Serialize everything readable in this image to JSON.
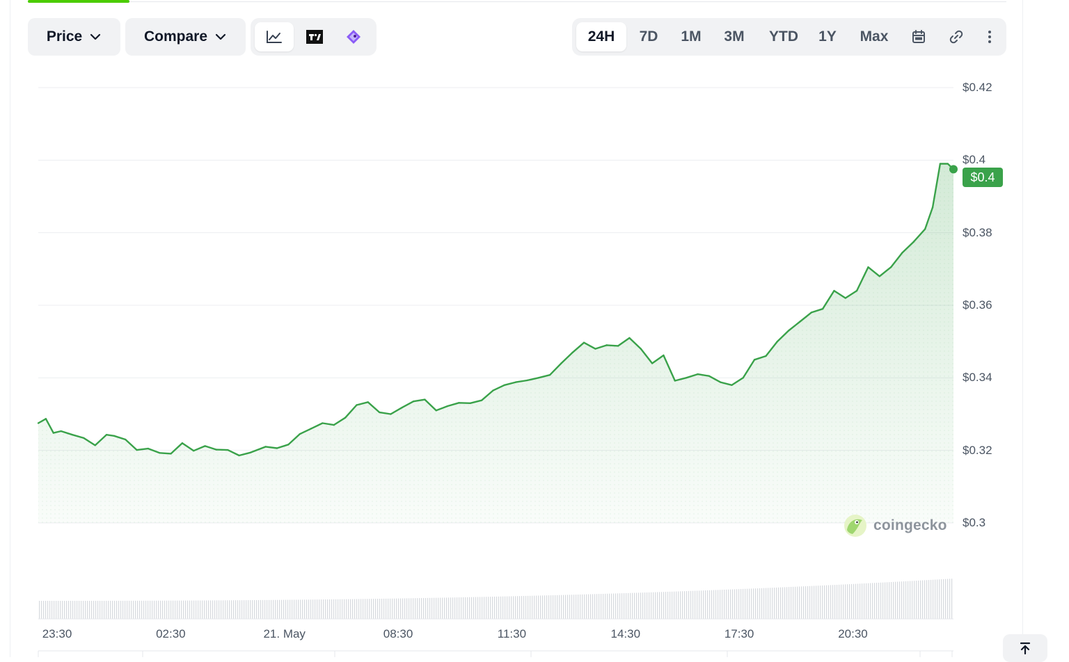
{
  "toolbar": {
    "price_label": "Price",
    "compare_label": "Compare",
    "chart_modes": [
      {
        "icon": "line-chart-icon",
        "active": true
      },
      {
        "icon": "tradingview-icon",
        "active": false
      },
      {
        "icon": "gecko-terminal-icon",
        "active": false
      }
    ],
    "ranges": [
      "24H",
      "7D",
      "1M",
      "3M",
      "YTD",
      "1Y",
      "Max"
    ],
    "active_range": "24H",
    "extra_icons": [
      "calendar-icon",
      "link-icon",
      "more-vertical-icon"
    ]
  },
  "current_price_label": "$0.4",
  "watermark": "coingecko",
  "colors": {
    "line": "#3aa24a",
    "badge": "#3aa24a",
    "tab_accent": "#4BCC00",
    "grid": "#eceef1",
    "axis_text": "#4b5563"
  },
  "chart_data": {
    "type": "area",
    "title": "",
    "xlabel": "",
    "ylabel": "",
    "ylim": [
      0.3,
      0.42
    ],
    "y_ticks": [
      "$0.42",
      "$0.4",
      "$0.38",
      "$0.36",
      "$0.34",
      "$0.32",
      "$0.3"
    ],
    "y_tick_values": [
      0.42,
      0.4,
      0.38,
      0.36,
      0.34,
      0.32,
      0.3
    ],
    "x_ticks": [
      "23:30",
      "02:30",
      "21. May",
      "08:30",
      "11:30",
      "14:30",
      "17:30",
      "20:30"
    ],
    "x_tick_hours": [
      0,
      3,
      6,
      9,
      12,
      15,
      18,
      21
    ],
    "xlim_hours": [
      0,
      24.15
    ],
    "grid": true,
    "series": [
      {
        "x_hours": [
          0,
          0.2,
          0.4,
          0.6,
          0.9,
          1.2,
          1.5,
          1.8,
          2.0,
          2.3,
          2.6,
          2.9,
          3.2,
          3.5,
          3.8,
          4.1,
          4.4,
          4.7,
          5.0,
          5.3,
          5.6,
          6.0,
          6.3,
          6.6,
          6.9,
          7.2,
          7.5,
          7.8,
          8.1,
          8.4,
          8.7,
          9.0,
          9.3,
          9.6,
          9.9,
          10.2,
          10.5,
          10.8,
          11.1,
          11.4,
          11.7,
          12.0,
          12.3,
          12.6,
          12.9,
          13.2,
          13.5,
          13.8,
          14.1,
          14.4,
          14.7,
          15.0,
          15.3,
          15.6,
          15.9,
          16.2,
          16.5,
          16.8,
          17.1,
          17.4,
          17.7,
          18.0,
          18.3,
          18.6,
          18.9,
          19.2,
          19.5,
          19.8,
          20.1,
          20.4,
          20.7,
          21.0,
          21.3,
          21.6,
          21.9,
          22.2,
          22.5,
          22.8,
          23.1,
          23.4,
          23.6,
          23.8,
          24.0,
          24.15
        ],
        "y": [
          0.3275,
          0.3287,
          0.3248,
          0.3253,
          0.3243,
          0.3234,
          0.3214,
          0.3243,
          0.324,
          0.323,
          0.3201,
          0.3205,
          0.3193,
          0.3191,
          0.322,
          0.3199,
          0.3212,
          0.3202,
          0.3201,
          0.3186,
          0.3194,
          0.321,
          0.3206,
          0.3216,
          0.3245,
          0.326,
          0.3275,
          0.327,
          0.329,
          0.3325,
          0.3333,
          0.3305,
          0.33,
          0.3318,
          0.3335,
          0.334,
          0.331,
          0.3322,
          0.3331,
          0.333,
          0.3338,
          0.3365,
          0.338,
          0.3388,
          0.3393,
          0.34,
          0.3408,
          0.344,
          0.347,
          0.3497,
          0.348,
          0.349,
          0.3488,
          0.351,
          0.348,
          0.344,
          0.3462,
          0.3392,
          0.34,
          0.341,
          0.3405,
          0.3388,
          0.338,
          0.34,
          0.345,
          0.346,
          0.35,
          0.353,
          0.3555,
          0.358,
          0.359,
          0.364,
          0.362,
          0.364,
          0.3705,
          0.368,
          0.3705,
          0.3745,
          0.3775,
          0.381,
          0.387,
          0.399,
          0.399,
          0.3975
        ]
      }
    ]
  }
}
